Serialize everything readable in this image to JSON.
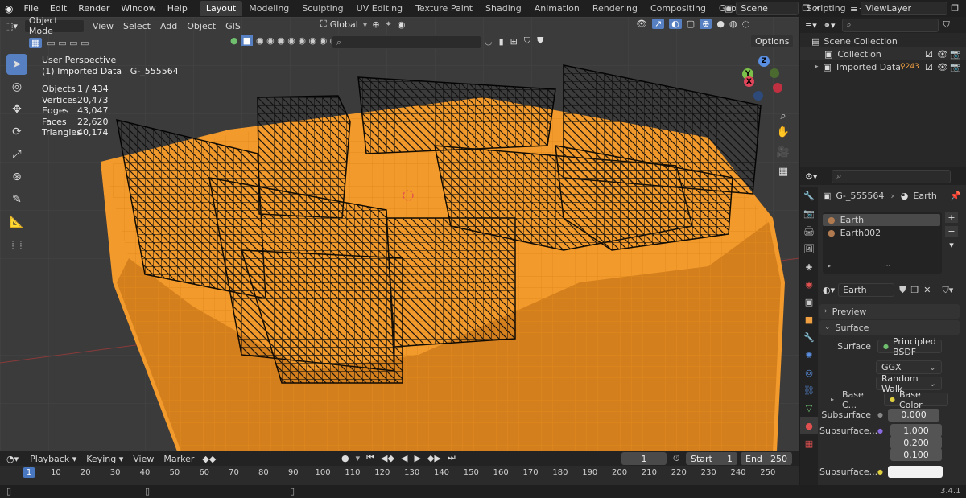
{
  "topbar": {
    "menus": [
      "File",
      "Edit",
      "Render",
      "Window",
      "Help"
    ],
    "workspaces": [
      "Layout",
      "Modeling",
      "Sculpting",
      "UV Editing",
      "Texture Paint",
      "Shading",
      "Animation",
      "Rendering",
      "Compositing",
      "Geometry Nodes",
      "Scripting"
    ],
    "active_workspace": "Layout",
    "add_tab": "+",
    "scene": "Scene",
    "view_layer": "ViewLayer"
  },
  "viewport": {
    "mode": "Object Mode",
    "menus": [
      "View",
      "Select",
      "Add",
      "Object",
      "GIS"
    ],
    "transform_orientation": "Global",
    "options": "Options",
    "overlay_title": "User Perspective",
    "overlay_sub": "(1) Imported Data | G-_555564",
    "stats": [
      {
        "k": "Objects",
        "v": "1 / 434"
      },
      {
        "k": "Vertices",
        "v": "20,473"
      },
      {
        "k": "Edges",
        "v": "43,047"
      },
      {
        "k": "Faces",
        "v": "22,620"
      },
      {
        "k": "Triangles",
        "v": "40,174"
      }
    ],
    "gizmo": {
      "z": "Z",
      "y": "Y",
      "x": "X"
    }
  },
  "outliner": {
    "root": "Scene Collection",
    "items": [
      {
        "label": "Collection"
      },
      {
        "label": "Imported Data",
        "badge": "243"
      }
    ]
  },
  "properties": {
    "object": "G-_555564",
    "material": "Earth",
    "slots": [
      "Earth",
      "Earth002"
    ],
    "material_field": "Earth",
    "panels": {
      "preview": "Preview",
      "surface": "Surface"
    },
    "surface": {
      "surface_label": "Surface",
      "surface_value": "Principled BSDF",
      "distribution": "GGX",
      "subsurface_method": "Random Walk",
      "base_color_label": "Base C...",
      "base_color_value": "Base Color",
      "subsurface_label": "Subsurface",
      "subsurface_value": "0.000",
      "subsurface_radius_label": "Subsurface...",
      "radius": [
        "1.000",
        "0.200",
        "0.100"
      ],
      "subsurface_color_label": "Subsurface..."
    }
  },
  "timeline": {
    "menus": [
      "Playback",
      "Keying",
      "View",
      "Marker"
    ],
    "current_frame": "1",
    "start_label": "Start",
    "start": "1",
    "end_label": "End",
    "end": "250",
    "ticks": [
      "1",
      "10",
      "20",
      "30",
      "40",
      "50",
      "60",
      "70",
      "80",
      "90",
      "100",
      "110",
      "120",
      "130",
      "140",
      "150",
      "160",
      "170",
      "180",
      "190",
      "200",
      "210",
      "220",
      "230",
      "240",
      "250"
    ]
  },
  "status": {
    "version": "3.4.1"
  },
  "colors": {
    "accent": "#5680c2",
    "selection": "#f5a030",
    "wire": "#111111"
  }
}
